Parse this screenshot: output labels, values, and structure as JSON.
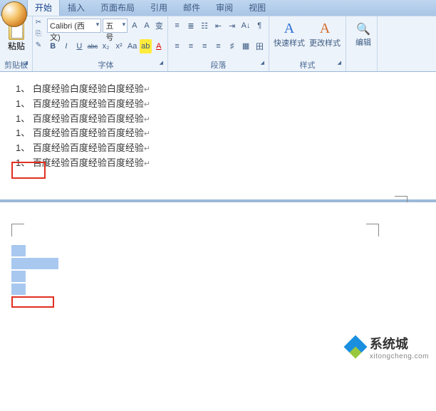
{
  "tabs": [
    "开始",
    "插入",
    "页面布局",
    "引用",
    "邮件",
    "审阅",
    "视图"
  ],
  "active_tab": "开始",
  "clipboard": {
    "paste": "粘贴",
    "label": "剪贴板"
  },
  "font": {
    "name": "Calibri (西文)",
    "size": "五号",
    "grow": "A",
    "shrink": "A",
    "clear": "变",
    "bold": "B",
    "italic": "I",
    "underline": "U",
    "strike": "abc",
    "sub": "x₂",
    "sup": "x²",
    "case": "Aa",
    "highlight": "ab",
    "color": "A",
    "label": "字体"
  },
  "para": {
    "bullets": "≡",
    "numbers": "≣",
    "multilevel": "☷",
    "dedent": "⇤",
    "indent": "⇥",
    "sort": "A↓",
    "showmarks": "¶",
    "align_l": "≡",
    "align_c": "≡",
    "align_r": "≡",
    "align_j": "≡",
    "spacing": "♯",
    "shading": "▦",
    "border": "田",
    "label": "段落"
  },
  "style": {
    "quick": "快速样式",
    "change": "更改样式",
    "label": "样式"
  },
  "edit": {
    "label": "编辑"
  },
  "doc_lines": [
    "1、 白度经验白度经验白度经验",
    "1、 百度经验百度经验百度经验",
    "1、 百度经验百度经验百度经验",
    "1、 百度经验百度经验百度经验",
    "1、 百度经验百度经验百度经验",
    "1、 百度经验百度经验百度经验"
  ],
  "watermark": {
    "brand": "系统城",
    "sub": "xitongcheng.com"
  }
}
